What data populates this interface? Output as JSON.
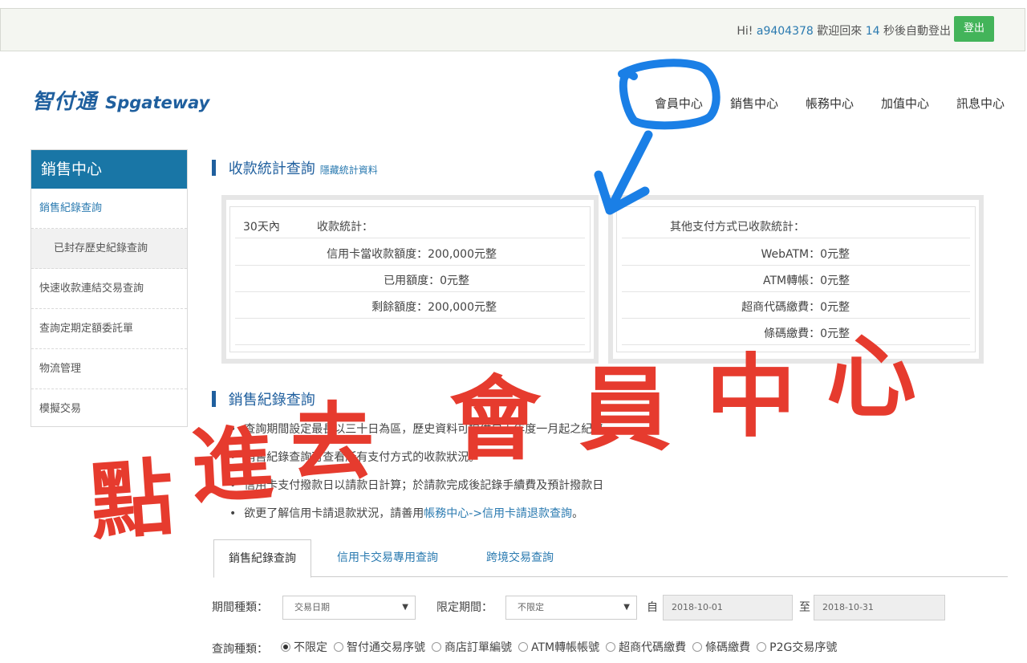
{
  "topbar": {
    "greeting_prefix": "Hi!",
    "username": "a9404378",
    "welcome": "歡迎回來",
    "countdown": "14",
    "countdown_suffix": "秒後自動登出",
    "logout_label": "登出"
  },
  "logo": {
    "zh": "智付通",
    "en": "Spgateway"
  },
  "main_nav": [
    "會員中心",
    "銷售中心",
    "帳務中心",
    "加值中心",
    "訊息中心"
  ],
  "sidebar": {
    "title": "銷售中心",
    "items": [
      {
        "label": "銷售紀錄查詢",
        "active": true,
        "sub": false
      },
      {
        "label": "已封存歷史紀錄查詢",
        "active": false,
        "sub": true
      },
      {
        "label": "快速收款連結交易查詢",
        "active": false,
        "sub": false
      },
      {
        "label": "查詢定期定額委託單",
        "active": false,
        "sub": false
      },
      {
        "label": "物流管理",
        "active": false,
        "sub": false
      },
      {
        "label": "模擬交易",
        "active": false,
        "sub": false
      }
    ]
  },
  "stats": {
    "title": "收款統計查詢",
    "toggle": "隱藏統計資料",
    "left": {
      "period": "30天內",
      "heading": "收款統計：",
      "rows": [
        "信用卡當收款額度：200,000元整",
        "已用額度：0元整",
        "剩餘額度：200,000元整"
      ]
    },
    "right": {
      "heading": "其他支付方式已收款統計：",
      "rows": [
        "WebATM：0元整",
        "ATM轉帳：0元整",
        "超商代碼繳費：0元整",
        "條碼繳費：0元整"
      ]
    }
  },
  "records": {
    "title": "銷售紀錄查詢",
    "bullets": [
      {
        "text": "查詢期間設定最長以三十日為區，歷史資料可提供自上年度一月起之紀錄。"
      },
      {
        "text": "銷售紀錄查詢可查看所有支付方式的收款狀況。"
      },
      {
        "text": "信用卡支付撥款日以請款日計算；於請款完成後記錄手續費及預計撥款日"
      },
      {
        "text": "欲更了解信用卡請退款狀況，請善用",
        "link": "帳務中心->信用卡請退款查詢",
        "suffix": "。"
      }
    ]
  },
  "tabs": [
    "銷售紀錄查詢",
    "信用卡交易專用查詢",
    "跨境交易查詢"
  ],
  "filters": {
    "period_type_label": "期間種類：",
    "period_type_value": "交易日期",
    "range_label": "限定期間：",
    "range_value": "不限定",
    "from_label": "自",
    "from_value": "2018-10-01",
    "to_label": "至",
    "to_value": "2018-10-31",
    "query_type_label": "查詢種類：",
    "query_types": [
      "不限定",
      "智付通交易序號",
      "商店訂單編號",
      "ATM轉帳帳號",
      "超商代碼繳費",
      "條碼繳費",
      "P2G交易序號"
    ]
  },
  "annotation": {
    "text": "點進去會員中心",
    "chars": [
      "點",
      "進",
      "去",
      "會",
      "員",
      "中",
      "心"
    ],
    "stroke_color": "#1a7fe6",
    "text_color": "#e63b2e"
  }
}
